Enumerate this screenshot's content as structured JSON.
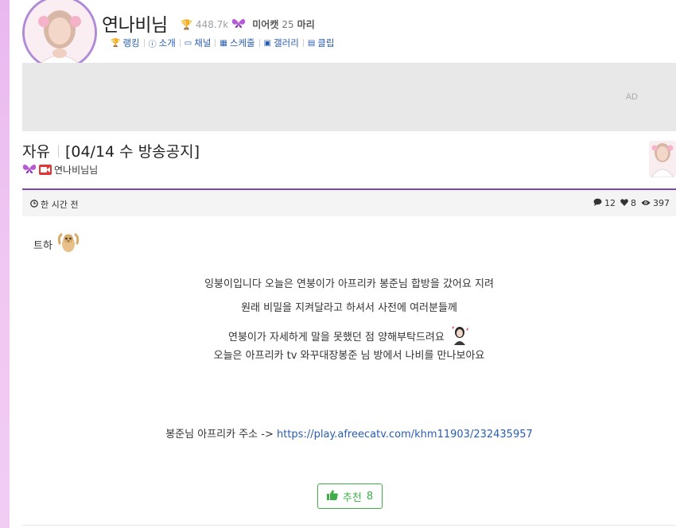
{
  "profile": {
    "name": "연나비님",
    "trophy_count": "448.7k",
    "fans_label": "미어캣",
    "fans_count": "25",
    "fans_unit": "마리"
  },
  "nav": [
    {
      "label": "랭킹",
      "icon": "trophy-icon"
    },
    {
      "label": "소개",
      "icon": "info-icon"
    },
    {
      "label": "채널",
      "icon": "channel-icon"
    },
    {
      "label": "스케줄",
      "icon": "calendar-icon"
    },
    {
      "label": "갤러리",
      "icon": "image-icon"
    },
    {
      "label": "클립",
      "icon": "film-icon"
    }
  ],
  "ad": {
    "label": "AD"
  },
  "post": {
    "category": "자유",
    "title": "[04/14 수 방송공지]",
    "author": "연나비님님",
    "time": "한 시간 전",
    "comments": "12",
    "likes": "8",
    "views": "397",
    "greeting": "트하",
    "lines": [
      "잉붕이입니다 오늘은 연붕이가 아프리카 봉준님 합방을 갔어요 지려",
      "원래 비밀을 지켜달라고 하셔서 사전에 여러분들께",
      "연붕이가 자세하게 말을 못했던 점 양해부탁드려요",
      "오늘은 아프리카 tv 와꾸대장봉준 님 방에서 나비를 만나보아요"
    ],
    "link_prefix": "봉준님 아프리카 주소 ->",
    "link_url": "https://play.afreecatv.com/khm11903/232435957",
    "recommend_label": "추천",
    "recommend_count": "8"
  },
  "colors": {
    "accent_purple": "#7b4aa5",
    "link_blue": "#2a5db0",
    "recommend_green": "#3fae49",
    "background_pink": "#efc7f2"
  }
}
